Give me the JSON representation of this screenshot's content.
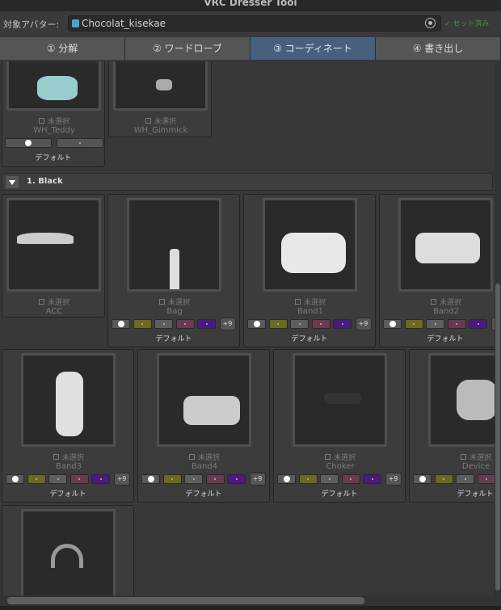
{
  "window": {
    "title": "VRC Dresser Tool"
  },
  "avatar": {
    "label": "対象アバター:",
    "value": "Chocolat_kisekae",
    "status": "✓ セット済み"
  },
  "tabs": [
    {
      "label": "① 分解"
    },
    {
      "label": "② ワードローブ"
    },
    {
      "label": "③ コーディネート"
    },
    {
      "label": "④ 書き出し"
    }
  ],
  "common": {
    "unselected": "未選択",
    "default": "デフォルト",
    "more": "+9"
  },
  "colors": {
    "white": "#5a5a5a",
    "olive": "#6b6a1e",
    "gray": "#5e5e5e",
    "mauve": "#6a3a50",
    "purple": "#4a1a80",
    "active_tab": "#46607e"
  },
  "top_items": [
    {
      "name": "WH_Teddy"
    },
    {
      "name": "WH_Gimmick"
    }
  ],
  "section": {
    "label": "1. Black"
  },
  "items": [
    {
      "name": "ACC"
    },
    {
      "name": "Bag"
    },
    {
      "name": "Band1"
    },
    {
      "name": "Band2"
    },
    {
      "name": "Band3"
    },
    {
      "name": "Band4"
    },
    {
      "name": "Choker"
    },
    {
      "name": "Device"
    }
  ]
}
